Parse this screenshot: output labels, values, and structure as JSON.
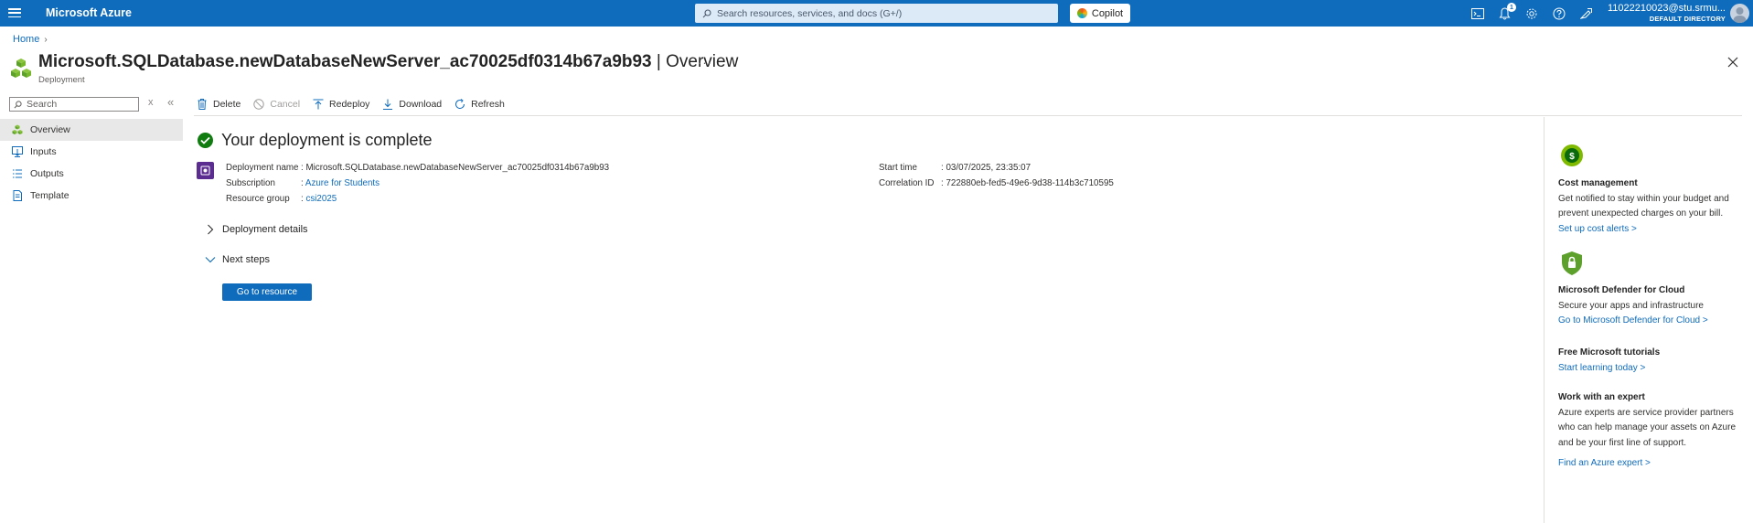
{
  "topbar": {
    "brand": "Microsoft Azure",
    "search_placeholder": "Search resources, services, and docs (G+/)",
    "copilot_label": "Copilot",
    "notification_count": "1",
    "account_name": "11022210023@stu.srmu...",
    "account_directory": "DEFAULT DIRECTORY"
  },
  "breadcrumb": {
    "home": "Home"
  },
  "header": {
    "resource_name": "Microsoft.SQLDatabase.newDatabaseNewServer_ac70025df0314b67a9b93",
    "separator": " | ",
    "section": "Overview",
    "subtitle": "Deployment",
    "more": "···"
  },
  "nav": {
    "search_placeholder": "Search",
    "items": [
      {
        "label": "Overview",
        "icon": "overview-icon"
      },
      {
        "label": "Inputs",
        "icon": "inputs-icon"
      },
      {
        "label": "Outputs",
        "icon": "outputs-icon"
      },
      {
        "label": "Template",
        "icon": "template-icon"
      }
    ]
  },
  "commands": {
    "delete": "Delete",
    "cancel": "Cancel",
    "redeploy": "Redeploy",
    "download": "Download",
    "refresh": "Refresh"
  },
  "main": {
    "status_title": "Your deployment is complete",
    "details": {
      "deployment_name_label": "Deployment name",
      "deployment_name": "Microsoft.SQLDatabase.newDatabaseNewServer_ac70025df0314b67a9b93",
      "subscription_label": "Subscription",
      "subscription": "Azure for Students",
      "resource_group_label": "Resource group",
      "resource_group": "csi2025",
      "start_time_label": "Start time",
      "start_time": "03/07/2025, 23:35:07",
      "correlation_id_label": "Correlation ID",
      "correlation_id": "722880eb-fed5-49e6-9d38-114b3c710595"
    },
    "deployment_details": "Deployment details",
    "next_steps": "Next steps",
    "go_to_resource": "Go to resource"
  },
  "right_panel": {
    "cost": {
      "title": "Cost management",
      "body": "Get notified to stay within your budget and prevent unexpected charges on your bill.",
      "link": "Set up cost alerts >"
    },
    "defender": {
      "title": "Microsoft Defender for Cloud",
      "body": "Secure your apps and infrastructure",
      "link": "Go to Microsoft Defender for Cloud >"
    },
    "tutorials": {
      "title": "Free Microsoft tutorials",
      "link": "Start learning today >"
    },
    "expert": {
      "title": "Work with an expert",
      "body": "Azure experts are service provider partners who can help manage your assets on Azure and be your first line of support.",
      "link": "Find an Azure expert >"
    }
  },
  "colors": {
    "brand_blue": "#0f6cbd",
    "success_green": "#107c10",
    "deployment_purple": "#5c2d91"
  }
}
